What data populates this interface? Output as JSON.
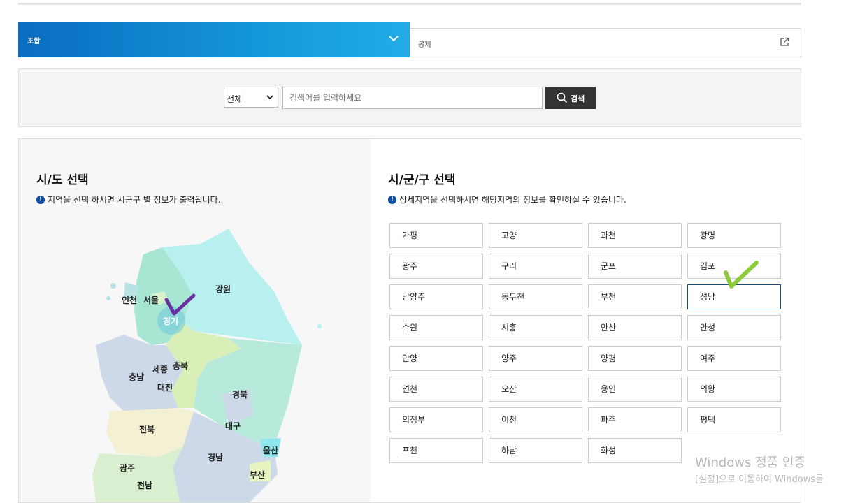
{
  "tabs": {
    "active_label": "조합",
    "other_label": "공제"
  },
  "search": {
    "scope_value": "전체",
    "placeholder": "검색어를 입력하세요",
    "button_label": "검색"
  },
  "sido": {
    "title": "시/도 선택",
    "notice": "지역을 선택 하시면 시군구 별 정보가 출력됩니다."
  },
  "sigungu": {
    "title": "시/군/구 선택",
    "notice": "상세지역을 선택하시면 해당지역의 정보를 확인하실 수 있습니다."
  },
  "map_labels": {
    "incheon": "인천",
    "seoul": "서울",
    "gyeonggi": "경기",
    "gangwon": "강원",
    "sejong": "세종",
    "chungbuk": "충북",
    "chungnam": "충남",
    "daejeon": "대전",
    "gyeongbuk": "경북",
    "daegu": "대구",
    "jeonbuk": "전북",
    "ulsan": "울산",
    "gyeongnam": "경남",
    "gwangju": "광주",
    "busan": "부산",
    "jeonnam": "전남"
  },
  "selected_region": "경기",
  "cities": [
    "가평",
    "고양",
    "과천",
    "광명",
    "광주",
    "구리",
    "군포",
    "김포",
    "남양주",
    "동두천",
    "부천",
    "성남",
    "수원",
    "시흥",
    "안산",
    "안성",
    "안양",
    "양주",
    "양평",
    "여주",
    "연천",
    "오산",
    "용인",
    "의왕",
    "의정부",
    "이천",
    "파주",
    "평택",
    "포천",
    "하남",
    "화성"
  ],
  "selected_city": "성남",
  "colors": {
    "tab_gradient_start": "#0a6cc0",
    "tab_gradient_end": "#22ace6",
    "search_button": "#333333",
    "selected_border": "#1f4d7a",
    "purple_mark": "#6a2fa0",
    "green_mark": "#8ccc3c"
  },
  "watermark": {
    "line1": "Windows 정품 인증",
    "line2": "[설정]으로 이동하여 Windows를"
  }
}
